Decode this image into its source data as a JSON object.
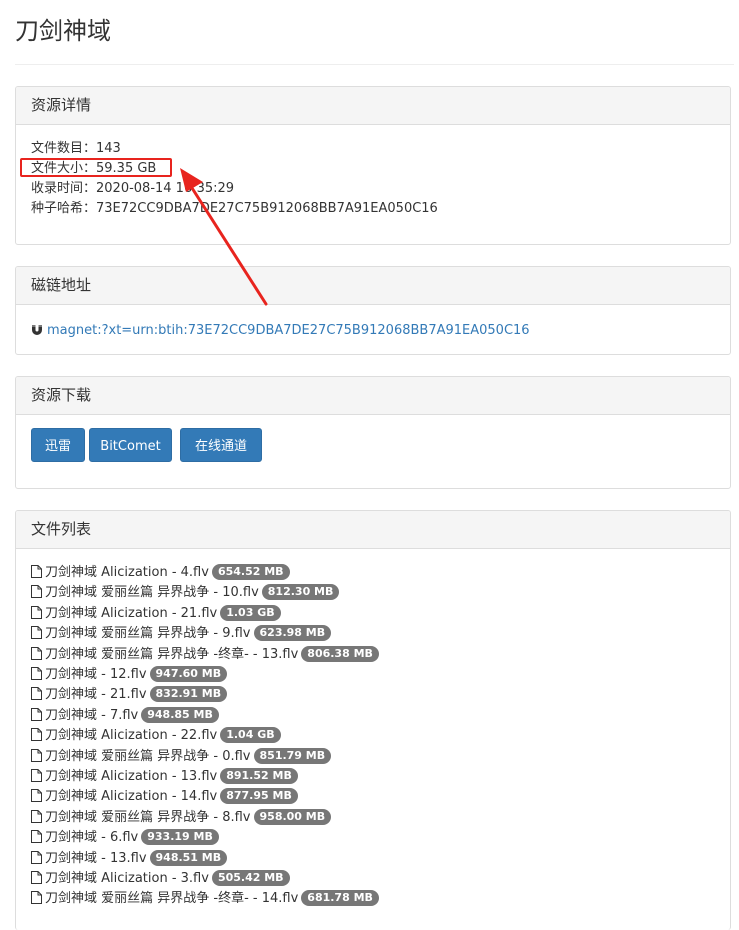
{
  "page": {
    "title": "刀剑神域"
  },
  "details": {
    "heading": "资源详情",
    "lines": [
      "文件数目：143",
      "文件大小：59.35 GB",
      "收录时间：2020-08-14 16:35:29",
      "种子哈希：73E72CC9DBA7DE27C75B912068BB7A91EA050C16"
    ]
  },
  "magnet": {
    "heading": "磁链地址",
    "link": "magnet:?xt=urn:btih:73E72CC9DBA7DE27C75B912068BB7A91EA050C16"
  },
  "download": {
    "heading": "资源下载",
    "buttons": [
      "迅雷",
      "BitComet",
      "在线通道"
    ]
  },
  "files": {
    "heading": "文件列表",
    "items": [
      {
        "name": "刀剑神域 Alicization - 4.flv",
        "size": "654.52 MB"
      },
      {
        "name": "刀剑神域 爱丽丝篇 异界战争 - 10.flv",
        "size": "812.30 MB"
      },
      {
        "name": "刀剑神域 Alicization - 21.flv",
        "size": "1.03 GB"
      },
      {
        "name": "刀剑神域 爱丽丝篇 异界战争 - 9.flv",
        "size": "623.98 MB"
      },
      {
        "name": "刀剑神域 爱丽丝篇 异界战争 -终章- - 13.flv",
        "size": "806.38 MB"
      },
      {
        "name": "刀剑神域 - 12.flv",
        "size": "947.60 MB"
      },
      {
        "name": "刀剑神域 - 21.flv",
        "size": "832.91 MB"
      },
      {
        "name": "刀剑神域 - 7.flv",
        "size": "948.85 MB"
      },
      {
        "name": "刀剑神域 Alicization - 22.flv",
        "size": "1.04 GB"
      },
      {
        "name": "刀剑神域 爱丽丝篇 异界战争 - 0.flv",
        "size": "851.79 MB"
      },
      {
        "name": "刀剑神域 Alicization - 13.flv",
        "size": "891.52 MB"
      },
      {
        "name": "刀剑神域 Alicization - 14.flv",
        "size": "877.95 MB"
      },
      {
        "name": "刀剑神域 爱丽丝篇 异界战争 - 8.flv",
        "size": "958.00 MB"
      },
      {
        "name": "刀剑神域 - 6.flv",
        "size": "933.19 MB"
      },
      {
        "name": "刀剑神域 - 13.flv",
        "size": "948.51 MB"
      },
      {
        "name": "刀剑神域 Alicization - 3.flv",
        "size": "505.42 MB"
      },
      {
        "name": "刀剑神域 爱丽丝篇 异界战争 -终章- - 14.flv",
        "size": "681.78 MB"
      }
    ]
  },
  "colors": {
    "link": "#337ab7",
    "button": "#337ab7",
    "badge": "#777777",
    "annotation": "#e8241e"
  }
}
